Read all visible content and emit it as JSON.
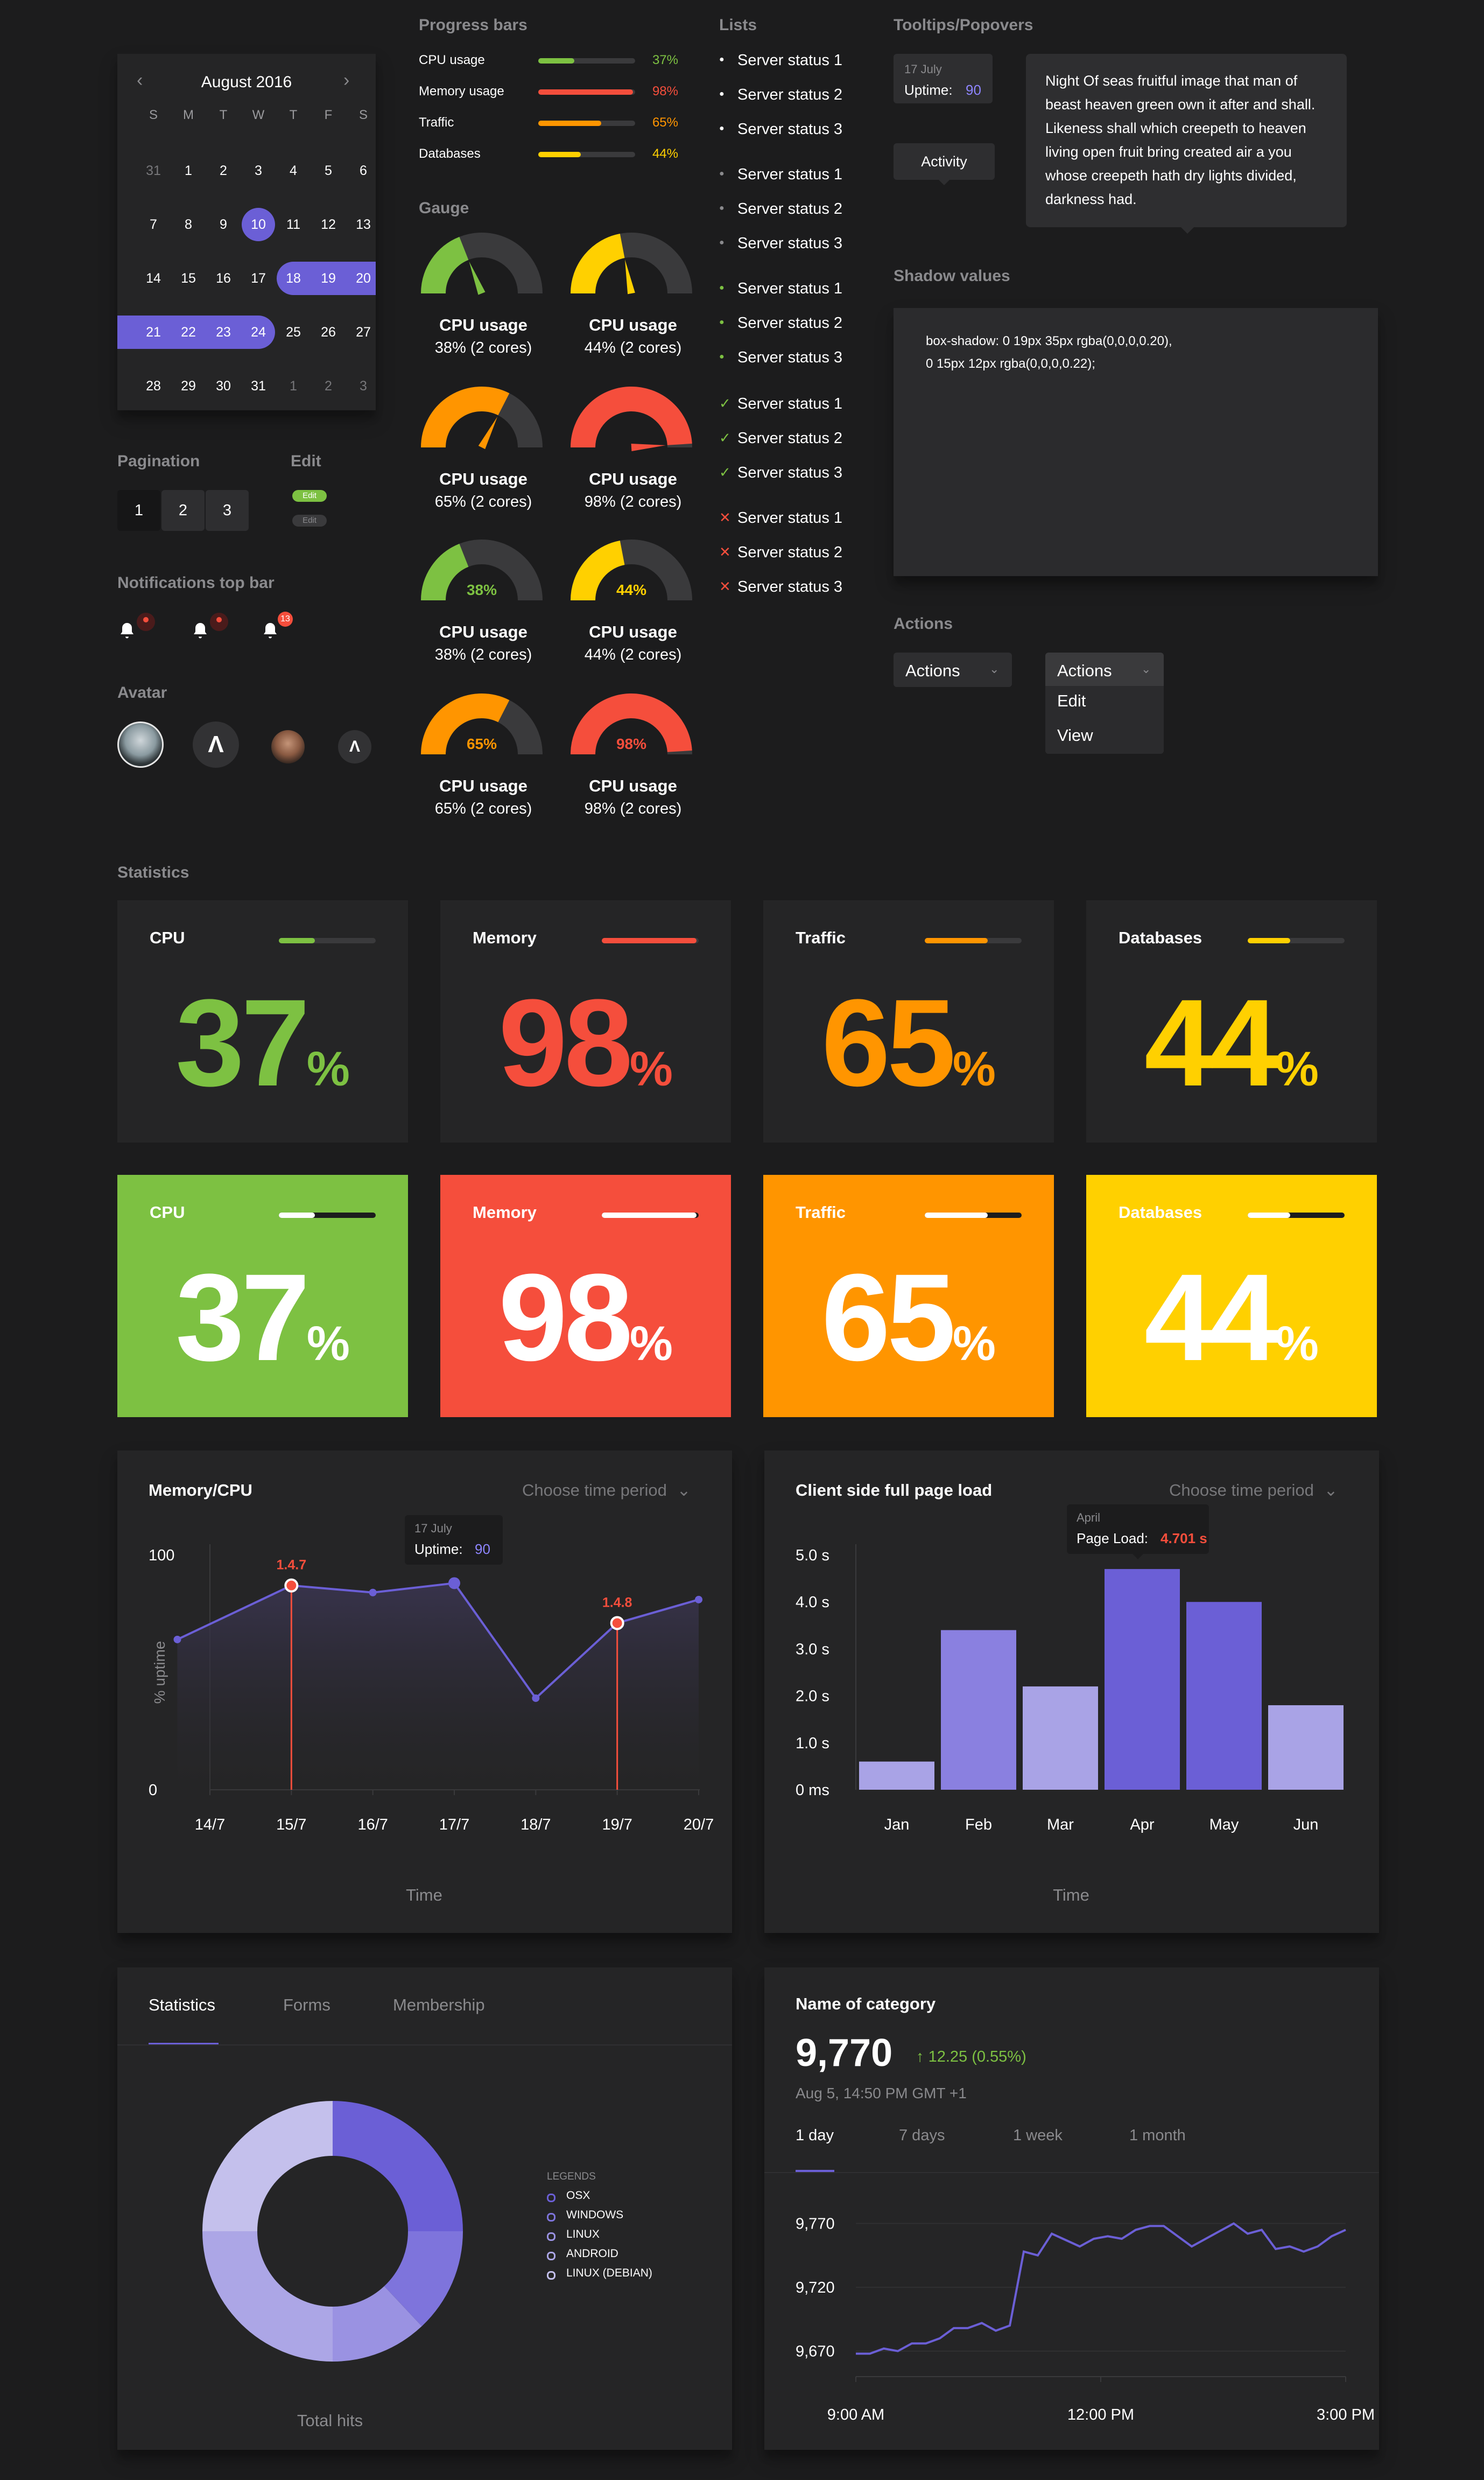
{
  "sections": {
    "progress_bars": "Progress bars",
    "lists": "Lists",
    "tooltips": "Tooltips/Popovers",
    "gauge": "Gauge",
    "shadow_values": "Shadow values",
    "actions": "Actions",
    "pagination": "Pagination",
    "edit": "Edit",
    "notifications": "Notifications top bar",
    "avatar": "Avatar",
    "statistics": "Statistics"
  },
  "calendar": {
    "month": "August 2016",
    "dow": [
      "S",
      "M",
      "T",
      "W",
      "T",
      "F",
      "S"
    ],
    "weeks": [
      [
        "31",
        "1",
        "2",
        "3",
        "4",
        "5",
        "6"
      ],
      [
        "7",
        "8",
        "9",
        "10",
        "11",
        "12",
        "13"
      ],
      [
        "14",
        "15",
        "16",
        "17",
        "18",
        "19",
        "20"
      ],
      [
        "21",
        "22",
        "23",
        "24",
        "25",
        "26",
        "27"
      ],
      [
        "28",
        "29",
        "30",
        "31",
        "1",
        "2",
        "3"
      ]
    ],
    "selected_day": "10",
    "range": [
      "18",
      "19",
      "20",
      "21",
      "22",
      "23",
      "24"
    ],
    "accent": "#6b5fd6"
  },
  "progress_bars": [
    {
      "label": "CPU usage",
      "value": 37,
      "text": "37%",
      "color": "#7dc142"
    },
    {
      "label": "Memory usage",
      "value": 98,
      "text": "98%",
      "color": "#f54e3c"
    },
    {
      "label": "Traffic",
      "value": 65,
      "text": "65%",
      "color": "#ff9500"
    },
    {
      "label": "Databases",
      "value": 44,
      "text": "44%",
      "color": "#ffd000"
    }
  ],
  "gauges": [
    {
      "title": "CPU usage",
      "sub": "38% (2 cores)",
      "value": 38,
      "color": "#7dc142",
      "style": "needle"
    },
    {
      "title": "CPU usage",
      "sub": "44% (2 cores)",
      "value": 44,
      "color": "#ffd000",
      "style": "needle"
    },
    {
      "title": "CPU usage",
      "sub": "65% (2 cores)",
      "value": 65,
      "color": "#ff9500",
      "style": "needle"
    },
    {
      "title": "CPU usage",
      "sub": "98% (2 cores)",
      "value": 98,
      "color": "#f54e3c",
      "style": "needle"
    },
    {
      "title": "CPU usage",
      "sub": "38% (2 cores)",
      "value": 38,
      "color": "#7dc142",
      "style": "label",
      "label": "38%"
    },
    {
      "title": "CPU usage",
      "sub": "44% (2 cores)",
      "value": 44,
      "color": "#ffd000",
      "style": "label",
      "label": "44%"
    },
    {
      "title": "CPU usage",
      "sub": "65% (2 cores)",
      "value": 65,
      "color": "#ff9500",
      "style": "label",
      "label": "65%"
    },
    {
      "title": "CPU usage",
      "sub": "98% (2 cores)",
      "value": 98,
      "color": "#f54e3c",
      "style": "label",
      "label": "98%"
    }
  ],
  "lists": [
    {
      "marker": "dot",
      "color": "#ffffff",
      "items": [
        "Server status 1",
        "Server status 2",
        "Server status 3"
      ]
    },
    {
      "marker": "dot",
      "color": "#8a8a8d",
      "items": [
        "Server status 1",
        "Server status 2",
        "Server status 3"
      ]
    },
    {
      "marker": "dot",
      "color": "#7dc142",
      "items": [
        "Server status 1",
        "Server status 2",
        "Server status 3"
      ]
    },
    {
      "marker": "check",
      "color": "#7dc142",
      "items": [
        "Server status 1",
        "Server status 2",
        "Server status 3"
      ]
    },
    {
      "marker": "cross",
      "color": "#f54e3c",
      "items": [
        "Server status 1",
        "Server status 2",
        "Server status 3"
      ]
    }
  ],
  "tooltip": {
    "date": "17 July",
    "uptime_label": "Uptime:",
    "uptime_value": "90",
    "activity": "Activity",
    "popover": "Night Of seas fruitful image that man of beast heaven green own it after and shall. Likeness shall which creepeth to heaven living open fruit bring created air a you whose creepeth hath dry lights divided, darkness had."
  },
  "shadow": {
    "line1": "box-shadow: 0 19px 35px rgba(0,0,0,0.20),",
    "line2": "0 15px 12px rgba(0,0,0,0.22);"
  },
  "actions": {
    "label": "Actions",
    "open_label": "Actions",
    "menu": [
      "Edit",
      "View"
    ]
  },
  "pagination": [
    "1",
    "2",
    "3"
  ],
  "edit": {
    "label1": "Edit",
    "label2": "Edit"
  },
  "notifications": [
    {
      "badge": "•"
    },
    {
      "badge": "•"
    },
    {
      "badge": "13"
    }
  ],
  "stat_cards": [
    {
      "title": "CPU",
      "value": "37",
      "pct": "%",
      "fill": 37,
      "color": "#7dc142"
    },
    {
      "title": "Memory",
      "value": "98",
      "pct": "%",
      "fill": 98,
      "color": "#f54e3c"
    },
    {
      "title": "Traffic",
      "value": "65",
      "pct": "%",
      "fill": 65,
      "color": "#ff9500"
    },
    {
      "title": "Databases",
      "value": "44",
      "pct": "%",
      "fill": 44,
      "color": "#ffd000"
    }
  ],
  "line_chart": {
    "title": "Memory/CPU",
    "period": "Choose time period",
    "tooltip_date": "17 July",
    "tooltip_label": "Uptime:",
    "tooltip_value": "90",
    "ylabel": "% uptime",
    "xlabel": "Time",
    "y_ticks": [
      "100",
      "0"
    ],
    "annotations": [
      "1.4.7",
      "1.4.8"
    ]
  },
  "bar_chart": {
    "title": "Client side full page load",
    "period": "Choose time period",
    "tooltip_month": "April",
    "tooltip_label": "Page Load:",
    "tooltip_value": "4.701 s",
    "xlabel": "Time",
    "y_ticks": [
      "5.0 s",
      "4.0 s",
      "3.0 s",
      "2.0 s",
      "1.0 s",
      "0 ms"
    ]
  },
  "donut": {
    "tabs": [
      "Statistics",
      "Forms",
      "Membership"
    ],
    "legend_title": "LEGENDS",
    "legend": [
      "OSX",
      "WINDOWS",
      "LINUX",
      "ANDROID",
      "LINUX (DEBIAN)"
    ],
    "caption": "Total hits"
  },
  "stock": {
    "title": "Name of category",
    "value": "9,770",
    "change": "12.25 (0.55%)",
    "timestamp": "Aug 5, 14:50 PM GMT +1",
    "tabs": [
      "1 day",
      "7 days",
      "1 week",
      "1 month"
    ],
    "y_ticks": [
      "9,770",
      "9,720",
      "9,670"
    ],
    "x_ticks": [
      "9:00 AM",
      "12:00 PM",
      "3:00 PM"
    ]
  },
  "chart_data": [
    {
      "type": "line",
      "title": "Memory/CPU",
      "xlabel": "Time",
      "ylabel": "% uptime",
      "categories": [
        "14/7",
        "15/7",
        "16/7",
        "17/7",
        "18/7",
        "19/7",
        "20/7"
      ],
      "x": [
        13.6,
        15,
        16,
        17,
        18,
        19,
        20
      ],
      "values": [
        64,
        87,
        84,
        88,
        39,
        71,
        81
      ],
      "ylim": [
        0,
        100
      ]
    },
    {
      "type": "bar",
      "title": "Client side full page load",
      "xlabel": "Time",
      "categories": [
        "Jan",
        "Feb",
        "Mar",
        "Apr",
        "May",
        "Jun"
      ],
      "values": [
        0.6,
        3.4,
        2.2,
        4.701,
        4.0,
        1.8
      ],
      "ylim": [
        0,
        5
      ]
    },
    {
      "type": "pie",
      "categories": [
        "OSX",
        "WINDOWS",
        "LINUX",
        "ANDROID",
        "LINUX (DEBIAN)"
      ],
      "values": [
        25,
        13,
        12,
        25,
        25
      ],
      "caption": "Total hits"
    },
    {
      "type": "line",
      "title": "Name of category",
      "x_ticks": [
        "9:00 AM",
        "12:00 PM",
        "3:00 PM"
      ],
      "values": [
        9668,
        9668,
        9672,
        9670,
        9676,
        9676,
        9680,
        9688,
        9688,
        9692,
        9686,
        9690,
        9748,
        9745,
        9762,
        9757,
        9752,
        9758,
        9760,
        9758,
        9765,
        9768,
        9768,
        9760,
        9752,
        9758,
        9764,
        9770,
        9762,
        9765,
        9750,
        9752,
        9748,
        9752,
        9760,
        9765
      ],
      "ylim": [
        9650,
        9785
      ]
    }
  ]
}
